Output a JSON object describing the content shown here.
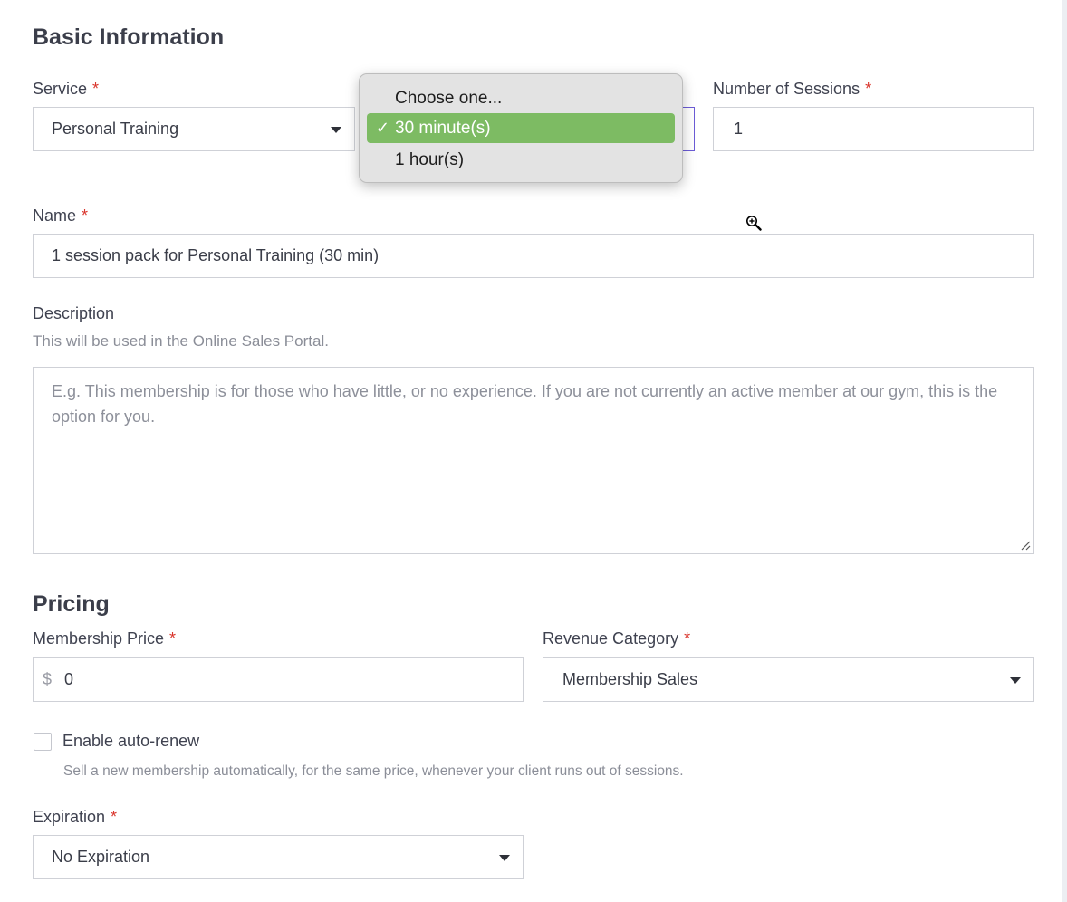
{
  "basic_info": {
    "heading": "Basic Information",
    "service": {
      "label": "Service",
      "required": "*",
      "value": "Personal Training"
    },
    "duration_popup": {
      "options": [
        "Choose one...",
        "30 minute(s)",
        "1 hour(s)"
      ],
      "selected": "30 minute(s)",
      "check": "✓"
    },
    "sessions": {
      "label": "Number of Sessions",
      "required": "*",
      "value": "1"
    },
    "name": {
      "label": "Name",
      "required": "*",
      "value": "1 session pack for Personal Training (30 min)"
    },
    "description": {
      "label": "Description",
      "hint": "This will be used in the Online Sales Portal.",
      "placeholder": "E.g. This membership is for those who have little, or no experience. If you are not currently an active member at our gym, this is the option for you."
    }
  },
  "pricing": {
    "heading": "Pricing",
    "price": {
      "label": "Membership Price",
      "required": "*",
      "currency": "$",
      "value": "0"
    },
    "revenue": {
      "label": "Revenue Category",
      "required": "*",
      "value": "Membership Sales"
    },
    "auto_renew": {
      "label": "Enable auto-renew",
      "checked": false,
      "hint": "Sell a new membership automatically, for the same price, whenever your client runs out of sessions."
    },
    "expiration": {
      "label": "Expiration",
      "required": "*",
      "value": "No Expiration"
    }
  },
  "cursor": {
    "icon": "zoom-in-icon"
  },
  "colors": {
    "accent_selected": "#7dbb63",
    "required": "#d9342b",
    "focus": "#6b5bd6"
  }
}
